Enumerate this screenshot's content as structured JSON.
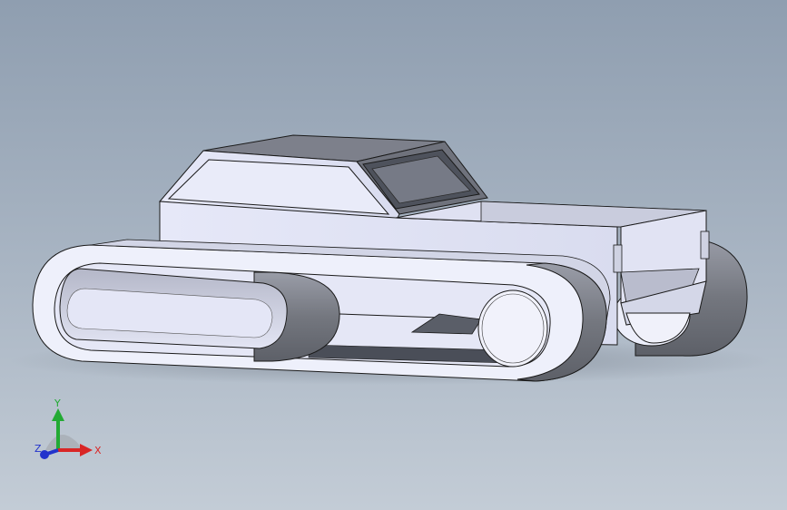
{
  "viewport": {
    "background_top": "#8f9eb0",
    "background_bottom": "#c3ccd6"
  },
  "model": {
    "body_color": "#e4e6f6",
    "shadow_color": "#8a8d98",
    "edge_color": "#1a1a1a",
    "track_outer_color": "#f0f1fa",
    "track_shadow_color": "#7f828d"
  },
  "triad": {
    "x_label": "X",
    "y_label": "Y",
    "z_label": "Z",
    "x_color": "#d92626",
    "y_color": "#22aa33",
    "z_color": "#2233cc",
    "icon": "coordinate-triad-icon"
  }
}
